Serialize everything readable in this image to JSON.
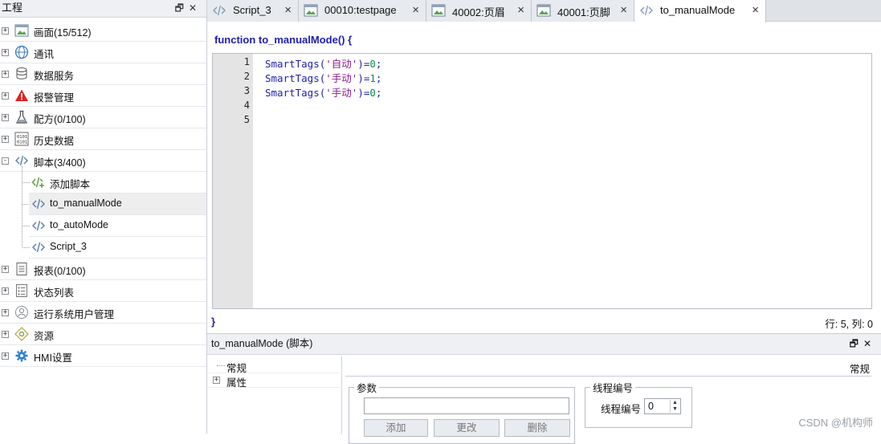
{
  "project_panel": {
    "title": "工程",
    "items": [
      {
        "label": "画面(15/512)",
        "icon": "screen-icon",
        "expander": "+"
      },
      {
        "label": "通讯",
        "icon": "globe-icon",
        "expander": "+"
      },
      {
        "label": "数据服务",
        "icon": "database-icon",
        "expander": "+"
      },
      {
        "label": "报警管理",
        "icon": "warning-icon",
        "expander": "+"
      },
      {
        "label": "配方(0/100)",
        "icon": "flask-icon",
        "expander": "+"
      },
      {
        "label": "历史数据",
        "icon": "binary-icon",
        "expander": "+"
      },
      {
        "label": "脚本(3/400)",
        "icon": "code-icon",
        "expander": "-"
      },
      {
        "label": "报表(0/100)",
        "icon": "report-icon",
        "expander": "+"
      },
      {
        "label": "状态列表",
        "icon": "list-icon",
        "expander": "+"
      },
      {
        "label": "运行系统用户管理",
        "icon": "user-icon",
        "expander": "+"
      },
      {
        "label": "资源",
        "icon": "resource-icon",
        "expander": "+"
      },
      {
        "label": "HMI设置",
        "icon": "gear-icon",
        "expander": "+"
      }
    ],
    "script_children": [
      {
        "label": "添加脚本",
        "icon": "add-script-icon"
      },
      {
        "label": "to_manualMode",
        "icon": "code-icon",
        "selected": true
      },
      {
        "label": "to_autoMode",
        "icon": "code-icon"
      },
      {
        "label": "Script_3",
        "icon": "code-icon"
      }
    ]
  },
  "tabs": [
    {
      "label": "Script_3",
      "icon": "code-icon",
      "close": "×",
      "active": false
    },
    {
      "label": "00010:testpage",
      "icon": "screen-icon",
      "close": "×",
      "active": false
    },
    {
      "label": "40002:页眉",
      "icon": "screen-icon",
      "close": "×",
      "active": false
    },
    {
      "label": "40001:页脚",
      "icon": "screen-icon",
      "close": "×",
      "active": false
    },
    {
      "label": "to_manualMode",
      "icon": "code-icon",
      "close": "×",
      "active": true
    }
  ],
  "editor": {
    "function_header": "function to_manualMode() {",
    "function_close": "}",
    "line_numbers": [
      "1",
      "2",
      "3",
      "4",
      "5"
    ],
    "lines": [
      {
        "fn": "SmartTags",
        "open": "(",
        "str": "'自动'",
        "close": ")",
        "op": "=",
        "num": "0",
        "end": ";"
      },
      {
        "fn": "SmartTags",
        "open": "(",
        "str": "'手动'",
        "close": ")",
        "op": "=",
        "num": "1",
        "end": ";"
      },
      {
        "fn": "SmartTags",
        "open": "(",
        "str": "'手动'",
        "close": ")",
        "op": "=",
        "num": "0",
        "end": ";"
      }
    ],
    "cursor_position": "行: 5, 列: 0"
  },
  "properties": {
    "title": "to_manualMode (脚本)",
    "tree": [
      {
        "label": "常规",
        "expander": ""
      },
      {
        "label": "属性",
        "expander": "+"
      }
    ],
    "section_title": "常规",
    "params_group": {
      "legend": "参数",
      "input_value": "",
      "buttons": [
        "添加",
        "更改",
        "删除"
      ]
    },
    "thread_group": {
      "legend": "线程编号",
      "label": "线程编号",
      "value": "0"
    }
  },
  "watermark": "CSDN @机构师",
  "colors": {
    "keyword_blue": "#1f1fb0",
    "string_purple": "#8b1b8b",
    "number_green": "#0a8a4a",
    "alarm_red": "#e02020",
    "gear_blue": "#2a7fd4"
  }
}
